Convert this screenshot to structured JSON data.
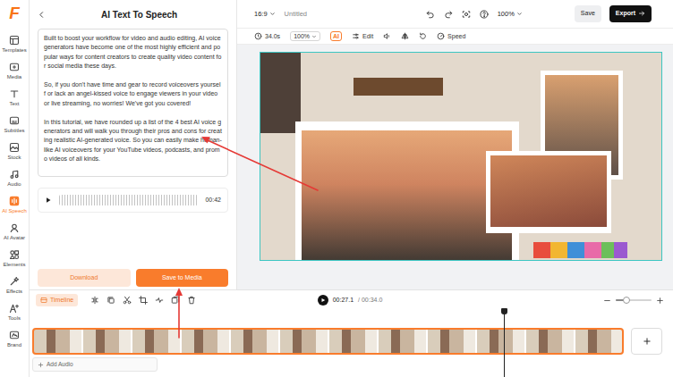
{
  "brand": {
    "logo": "F"
  },
  "sidebar": {
    "items": [
      {
        "label": "Templates",
        "selected": false
      },
      {
        "label": "Media",
        "selected": false
      },
      {
        "label": "Text",
        "selected": false
      },
      {
        "label": "Subtitles",
        "selected": false
      },
      {
        "label": "Stock",
        "selected": false
      },
      {
        "label": "Audio",
        "selected": false
      },
      {
        "label": "AI Speech",
        "selected": true
      },
      {
        "label": "AI Avatar",
        "selected": false
      },
      {
        "label": "Elements",
        "selected": false
      },
      {
        "label": "Effects",
        "selected": false
      },
      {
        "label": "Tools",
        "selected": false
      },
      {
        "label": "Brand",
        "selected": false
      }
    ]
  },
  "panel": {
    "title": "AI Text To Speech",
    "script": [
      "Built to boost your workflow for video and audio editing, AI voice generators have become one of the most highly efficient and popular ways for content creators to create quality video content for social media these days.",
      "So, if you don't have time and gear to record voiceovers yourself or lack an angel-kissed voice to engage viewers in your video or live streaming, no worries! We've got you covered!",
      "In this tutorial, we have rounded up a list of the 4 best AI voice generators and will walk you through their pros and cons for creating realistic AI-generated voice. So you can easily make human-like AI voiceovers for your YouTube videos, podcasts, and promo videos of all kinds."
    ],
    "player": {
      "duration": "00:42"
    },
    "buttons": [
      {
        "label": "Download",
        "kind": "secondary"
      },
      {
        "label": "Save to Media",
        "kind": "primary"
      }
    ]
  },
  "topbar": {
    "aspect": "16:9",
    "project": "Untitled",
    "zoom": "100%",
    "buttons": [
      {
        "label": "Save",
        "kind": "secondary"
      },
      {
        "label": "Export",
        "kind": "primary"
      }
    ]
  },
  "toolbar": {
    "duration": "34.0s",
    "zoom": "100%",
    "ai": "AI",
    "edit": "Edit",
    "speed": "Speed"
  },
  "canvas": {
    "selected": true
  },
  "timeline": {
    "tab": "Timeline",
    "current": "00:27.1",
    "total": "/ 00:34.0",
    "playhead": {
      "level": 0.797
    },
    "zoom": {
      "level": 0.3
    },
    "add_audio": "Add Audio"
  }
}
